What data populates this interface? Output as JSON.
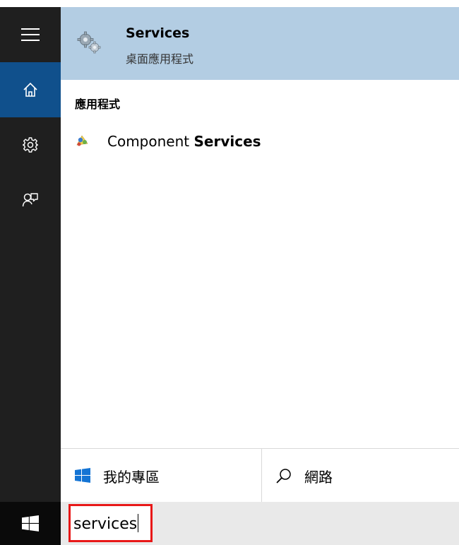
{
  "best_match": {
    "title": "Services",
    "subtitle": "桌面應用程式",
    "icon": "services-gear-icon"
  },
  "apps_section": {
    "header": "應用程式",
    "items": [
      {
        "label_prefix": "Component ",
        "label_match": "Services",
        "icon": "component-services-icon"
      }
    ]
  },
  "scopes": {
    "my_stuff": {
      "label": "我的專區",
      "icon": "windows-logo-icon"
    },
    "web": {
      "label": "網路",
      "icon": "search-icon"
    }
  },
  "search": {
    "value": "services"
  },
  "rail": {
    "items": [
      "menu-icon",
      "home-icon",
      "settings-gear-icon",
      "feedback-icon"
    ],
    "active": "home-icon"
  },
  "colors": {
    "rail_bg": "#1f1f1f",
    "rail_active": "#10508c",
    "best_match_bg": "#b3cde3",
    "highlight_border": "#e81818"
  }
}
